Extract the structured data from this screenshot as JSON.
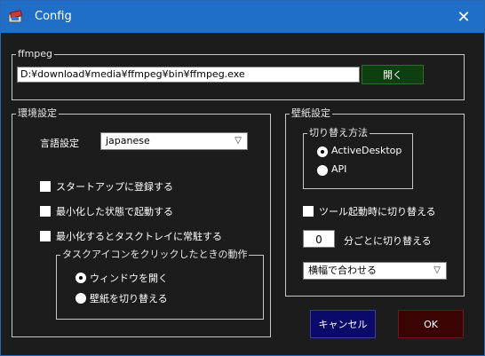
{
  "window": {
    "title": "Config",
    "close_glyph": "✕"
  },
  "ffmpeg": {
    "legend": "ffmpeg",
    "path_value": "D:¥download¥media¥ffmpeg¥bin¥ffmpeg.exe",
    "open_button": "開く"
  },
  "env": {
    "legend": "環境設定",
    "language_label": "言語設定",
    "language_value": "japanese",
    "startup_label": "スタートアップに登録する",
    "start_minimized_label": "最小化した状態で起動する",
    "tray_label": "最小化するとタスクトレイに常駐する",
    "tray_click": {
      "legend": "タスクアイコンをクリックしたときの動作",
      "options": [
        "ウィンドウを開く",
        "壁紙を切り替える"
      ],
      "selected": 0
    }
  },
  "wallpaper": {
    "legend": "壁紙設定",
    "switch_method": {
      "legend": "切り替え方法",
      "options": [
        "ActiveDesktop",
        "API"
      ],
      "selected": 0
    },
    "switch_on_launch_label": "ツール起動時に切り替える",
    "interval_value": "0",
    "interval_label": "分ごとに切り替える",
    "fit_value": "横幅で合わせる"
  },
  "buttons": {
    "cancel": "キャンセル",
    "ok": "OK"
  },
  "icons": {
    "app": "config-app-icon",
    "close": "close-icon",
    "dropdown": "chevron-down-icon"
  },
  "colors": {
    "titlebar": "#1f6fc9",
    "background": "#1c1c1c",
    "open_button": "#0e3f0e",
    "cancel_button": "#0a0a6a",
    "ok_button": "#3a0404"
  }
}
